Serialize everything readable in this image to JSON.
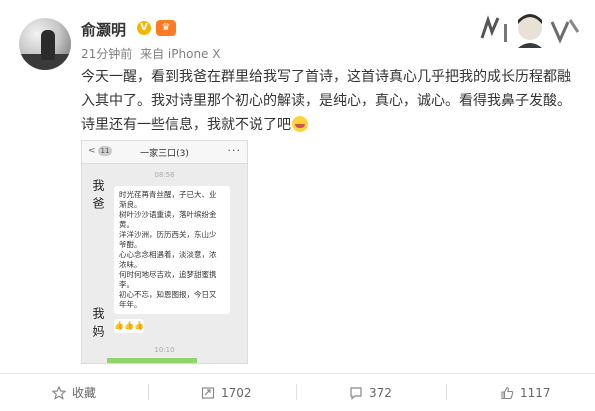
{
  "post": {
    "username": "俞灏明",
    "meta": {
      "time": "21分钟前",
      "source": "来自 iPhone X"
    },
    "content_lines": [
      "今天一醒，看到我爸在群里给我写了首诗，这首诗真心几乎把我的成长历程都融",
      "入其中了。我对诗里那个初心的解读，是纯心，真心，诚心。看得我鼻子发酸。",
      "诗里还有一些信息，我就不说了吧"
    ]
  },
  "chat": {
    "back_label": "<",
    "back_count": "11",
    "title": "一家三口(3)",
    "more": "···",
    "time1": "08:56",
    "sender1": "我爸",
    "poem": [
      "时光荏苒青丝醒，子已大、业",
      "渐良。",
      "树叶沙沙语重读，落叶缤纷金",
      "黄。",
      "洋洋沙洲，历历西关，东山少",
      "爷酣。",
      "心心念念相遇着，淡淡意，浓",
      "浓味。",
      "何时何地尽吉欢，追梦甜蜜携",
      "李。",
      "初心不忘，知恩图报，今日又",
      "年年。"
    ],
    "sender2": "我妈",
    "emojis": "👍👍👍",
    "time2": "10:10"
  },
  "footer": {
    "favorite": "收藏",
    "repost": "1702",
    "comment": "372",
    "like": "1117"
  },
  "colors": {
    "accent": "#ff8200",
    "verify": "#f7b500",
    "text": "#333333",
    "meta": "#808080"
  }
}
